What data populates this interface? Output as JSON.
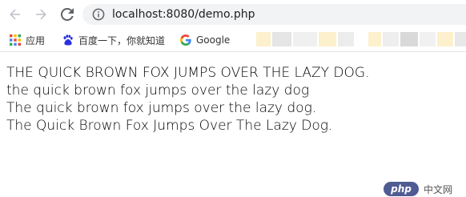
{
  "browser": {
    "url": "localhost:8080/demo.php",
    "bookmarks": [
      {
        "label": "应用",
        "icon": "apps-grid-icon"
      },
      {
        "label": "百度一下，你就知道",
        "icon": "baidu-paw-icon"
      },
      {
        "label": "Google",
        "icon": "google-g-icon"
      }
    ]
  },
  "page": {
    "lines": [
      "THE QUICK BROWN FOX JUMPS OVER THE LAZY DOG.",
      "the quick brown fox jumps over the lazy dog",
      "The quick brown fox jumps over the lazy dog.",
      "The Quick Brown Fox Jumps Over The Lazy Dog."
    ]
  },
  "watermark": {
    "badge": "php",
    "text": "中文网"
  },
  "colors": {
    "address_bar": "#f1f3f4",
    "icon_gray": "#5f6368",
    "php_badge": "#4f5b93"
  }
}
